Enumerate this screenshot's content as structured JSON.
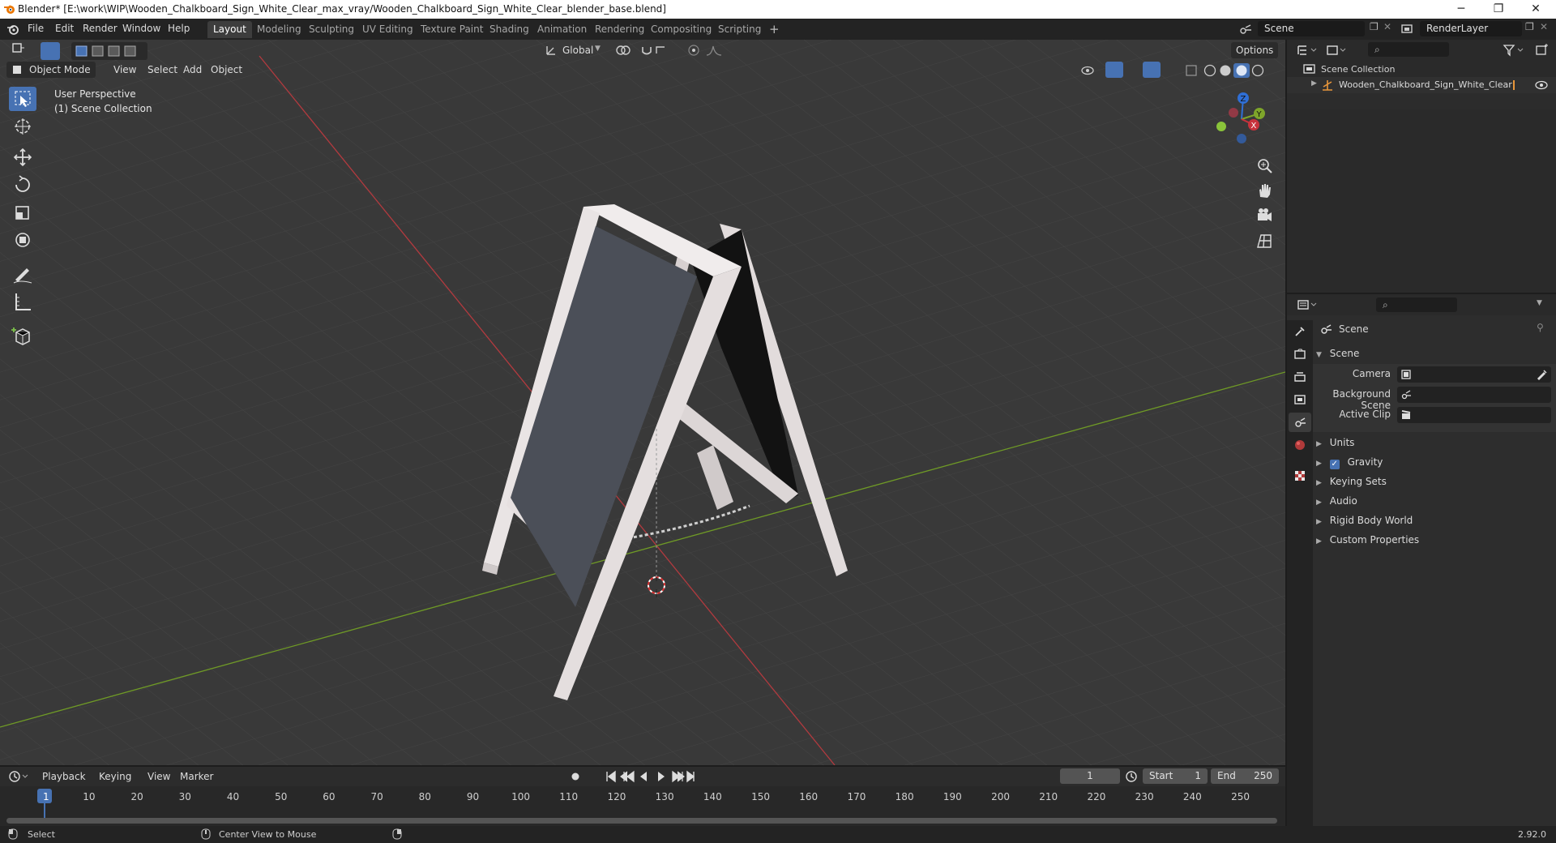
{
  "window": {
    "title": "Blender* [E:\\work\\WIP\\Wooden_Chalkboard_Sign_White_Clear_max_vray/Wooden_Chalkboard_Sign_White_Clear_blender_base.blend]",
    "minimize": "─",
    "maximize": "❐",
    "close": "✕"
  },
  "menu": [
    "File",
    "Edit",
    "Render",
    "Window",
    "Help"
  ],
  "workspaces": [
    "Layout",
    "Modeling",
    "Sculpting",
    "UV Editing",
    "Texture Paint",
    "Shading",
    "Animation",
    "Rendering",
    "Compositing",
    "Scripting"
  ],
  "workspace_add": "+",
  "scene_field": "Scene",
  "renderlayer_field": "RenderLayer",
  "viewport": {
    "mode": "Object Mode",
    "menus": [
      "View",
      "Select",
      "Add",
      "Object"
    ],
    "transform_orientation": "Global",
    "options": "Options",
    "perspective_label": "User Perspective",
    "collection_label": "(1) Scene Collection",
    "gizmo": {
      "z": "Z",
      "y": "Y",
      "x": "X"
    }
  },
  "outliner": {
    "root": "Scene Collection",
    "items": [
      {
        "name": "Wooden_Chalkboard_Sign_White_Clear"
      }
    ]
  },
  "properties": {
    "context": "Scene",
    "panel_scene": "Scene",
    "fields": [
      {
        "label": "Camera"
      },
      {
        "label": "Background Scene"
      },
      {
        "label": "Active Clip"
      }
    ],
    "subpanels": [
      "Units",
      "Gravity",
      "Keying Sets",
      "Audio",
      "Rigid Body World",
      "Custom Properties"
    ],
    "gravity_checked": true
  },
  "timeline": {
    "menus": [
      "Playback",
      "Keying",
      "View",
      "Marker"
    ],
    "current_frame": "1",
    "start_label": "Start",
    "start": "1",
    "end_label": "End",
    "end": "250",
    "ticks": [
      "1",
      "10",
      "20",
      "30",
      "40",
      "50",
      "60",
      "70",
      "80",
      "90",
      "100",
      "110",
      "120",
      "130",
      "140",
      "150",
      "160",
      "170",
      "180",
      "190",
      "200",
      "210",
      "220",
      "230",
      "240",
      "250"
    ]
  },
  "statusbar": {
    "left": "Select",
    "middle": "Center View to Mouse",
    "version": "2.92.0"
  },
  "colors": {
    "accent": "#4772b3",
    "x_axis": "#c8323c",
    "y_axis": "#7ea52a",
    "z_axis": "#2f6fd6"
  }
}
